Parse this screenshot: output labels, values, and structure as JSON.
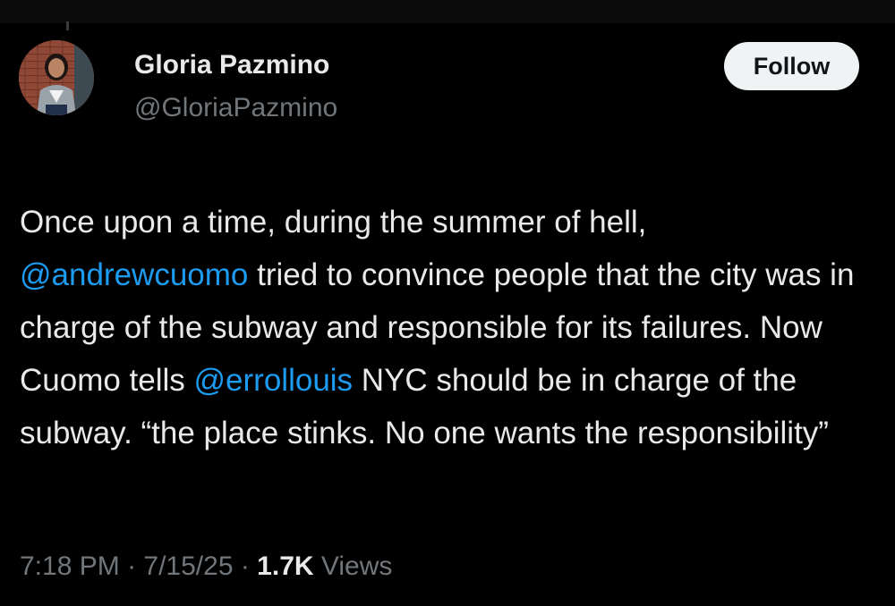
{
  "author": {
    "name": "Gloria Pazmino",
    "handle": "@GloriaPazmino"
  },
  "follow_label": "Follow",
  "tweet": {
    "segments": [
      "Once upon a time, during the summer of hell, ",
      "@andrewcuomo",
      " tried to convince people that the city was in charge of the subway and responsible for its failures. Now Cuomo tells ",
      "@errollouis",
      " NYC should be in charge of the subway. “the place stinks. No one wants the responsibility”"
    ]
  },
  "meta": {
    "time": "7:18 PM",
    "date": "7/15/25",
    "separator": " · ",
    "views_count": "1.7K",
    "views_label": " Views"
  },
  "colors": {
    "background": "#000000",
    "text": "#e7e9ea",
    "secondary": "#71767b",
    "link": "#1d9bf0",
    "button_bg": "#eff3f4"
  }
}
